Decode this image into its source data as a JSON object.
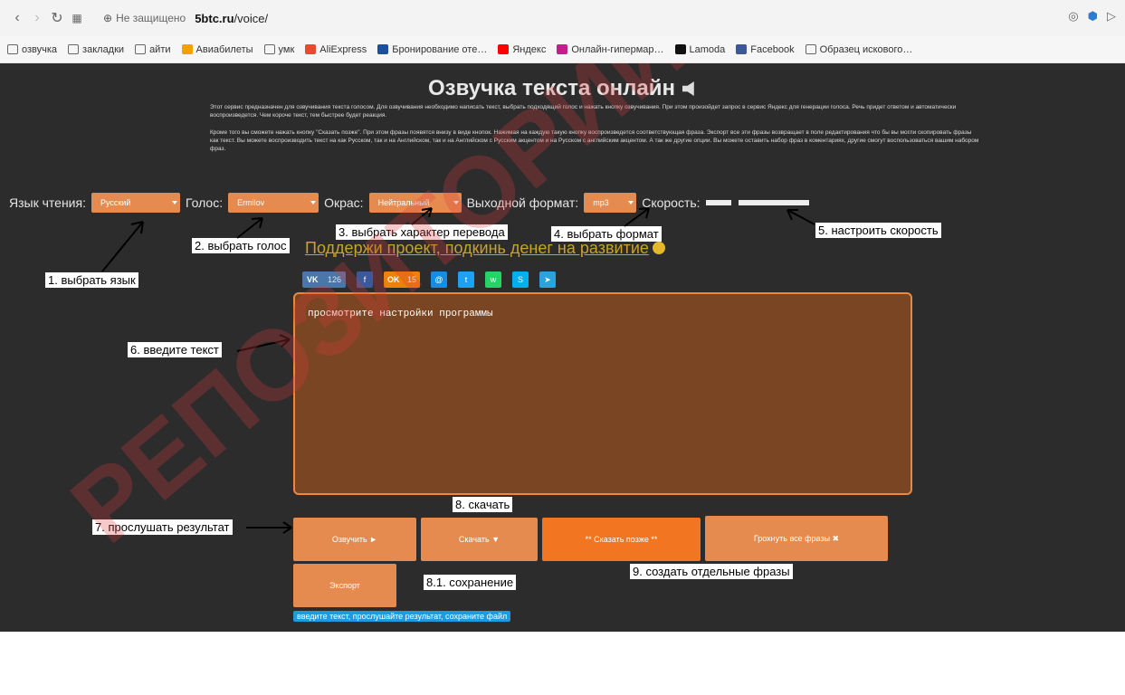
{
  "browser": {
    "url_security": "Не защищено",
    "url_domain": "5btc.ru",
    "url_path": "/voice/",
    "bookmarks": [
      {
        "label": "озвучка",
        "color": ""
      },
      {
        "label": "закладки",
        "color": ""
      },
      {
        "label": "айти",
        "color": ""
      },
      {
        "label": "Авиабилеты",
        "color": "#f2a100"
      },
      {
        "label": "умк",
        "color": ""
      },
      {
        "label": "AliExpress",
        "color": "#e64b2e"
      },
      {
        "label": "Бронирование оте…",
        "color": "#1d4f9c"
      },
      {
        "label": "Яндекс",
        "color": "#ff0000"
      },
      {
        "label": "Онлайн-гипермар…",
        "color": "#c21f8c"
      },
      {
        "label": "Lamoda",
        "color": "#111111"
      },
      {
        "label": "Facebook",
        "color": "#3b5998"
      },
      {
        "label": "Образец искового…",
        "color": ""
      }
    ]
  },
  "page": {
    "title": "Озвучка текста онлайн",
    "description_1": "Этот сервис предназначен для озвучивания текста голосом. Для озвучивания необходимо написать текст, выбрать подходящий голос и нажать кнопку озвучивания. При этом произойдет запрос в сервис Яндекс для генерации голоса. Речь придет ответом и автоматически воспроизведется. Чем короче текст, тем быстрее будет реакция.",
    "description_2": "Кроме того вы сможете нажать кнопку \"Сказать позже\". При этом фразы появятся внизу в виде кнопок. Нажимая на каждую такую кнопку воспроизведется соответствующая фраза. Экспорт все эти фразы возвращает в поле редактирования что бы вы могли скопировать фразы как текст. Вы можете воспроизводить текст на как Русском, так и на Английском, так и на Английском с Русским акцентом и на Русском с английским акцентом. А так же другие опции. Вы можете оставить набор фраз в коментариях, другие смогут воспользоваться вашим набором фраз.",
    "controls": {
      "language_label": "Язык чтения:",
      "language_value": "Русский",
      "voice_label": "Голос:",
      "voice_value": "Ermilov",
      "emotion_label": "Окрас:",
      "emotion_value": "Нейтральный",
      "format_label": "Выходной формат:",
      "format_value": "mp3",
      "speed_label": "Скорость:"
    },
    "support_link": "Поддержи проект, подкинь денег на развитие",
    "social": {
      "vk": "VK",
      "vk_count": "126",
      "fb": "f",
      "ok": "OK",
      "ok_count": "15",
      "mm": "@",
      "tw": "t",
      "wa": "w",
      "sk": "S",
      "tg": "➤"
    },
    "textarea_value": "просмотрите настройки программы",
    "buttons": {
      "speak": "Озвучить ►",
      "download": "Скачать ▼",
      "later": "** Сказать позже **",
      "delete_all": "Грохнуть все фразы ✖",
      "export": "Экспорт"
    },
    "hint": "введите текст, прослушайте результат, сохраните файл"
  },
  "annotations": {
    "a1": "1. выбрать язык",
    "a2": "2. выбрать голос",
    "a3": "3. выбрать характер перевода",
    "a4": "4. выбрать формат",
    "a5": "5. настроить скорость",
    "a6": "6. введите текст",
    "a7": "7. прослушать результат",
    "a8": "8. скачать",
    "a81": "8.1. сохранение",
    "a9": "9. создать отдельные фразы"
  },
  "watermark": "РЕПОЗИТОРИЙ",
  "colors": {
    "page_bg": "#2c2c2c",
    "accent_orange": "#e58b4f",
    "bright_orange": "#f27521",
    "textarea_bg": "#7a4522",
    "hint_blue": "#1e9adf"
  }
}
